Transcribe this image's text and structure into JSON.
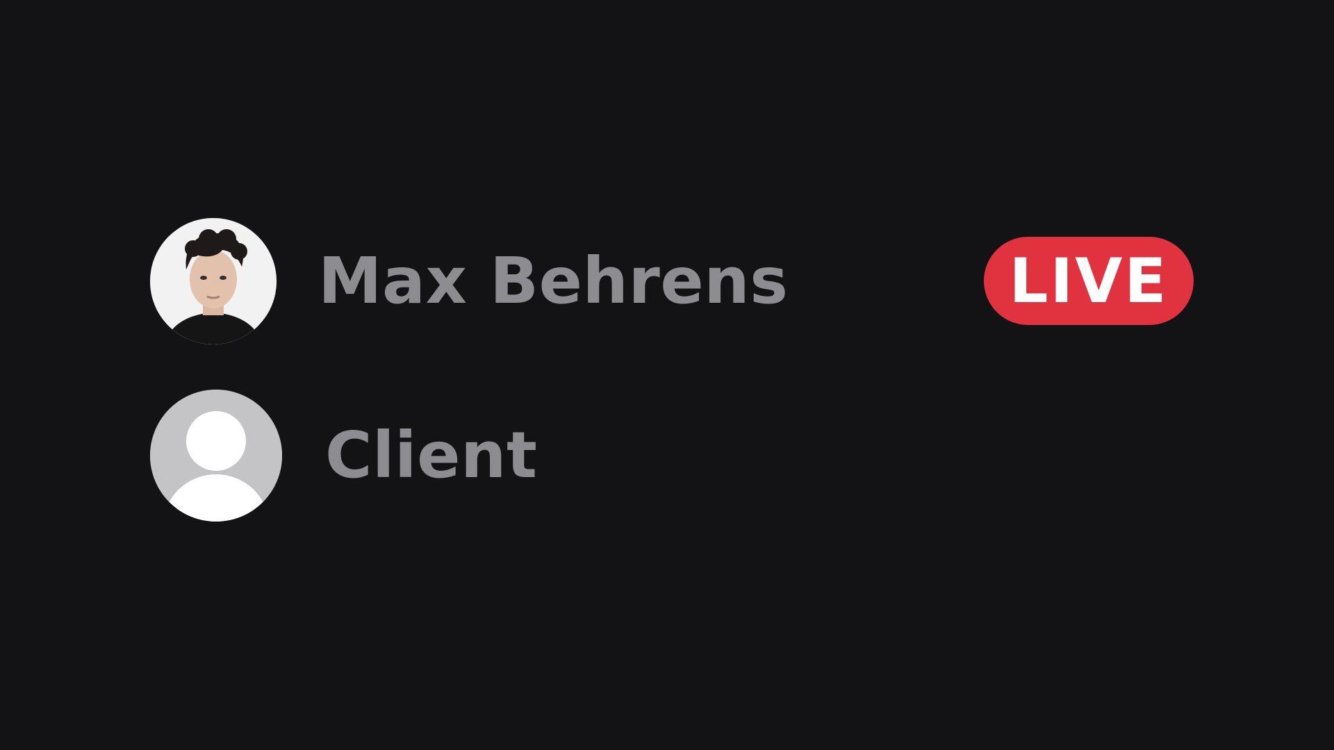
{
  "members": [
    {
      "name": "Max Behrens",
      "avatar_icon": "user-photo-avatar",
      "live": true,
      "badge_label": "LIVE"
    },
    {
      "name": "Client",
      "avatar_icon": "default-user-avatar-icon",
      "live": false
    }
  ],
  "colors": {
    "background": "#131316",
    "name_text": "#8c8c91",
    "live_badge": "#e0333f",
    "live_text": "#ffffff",
    "placeholder_avatar": "#c4c4c6"
  }
}
